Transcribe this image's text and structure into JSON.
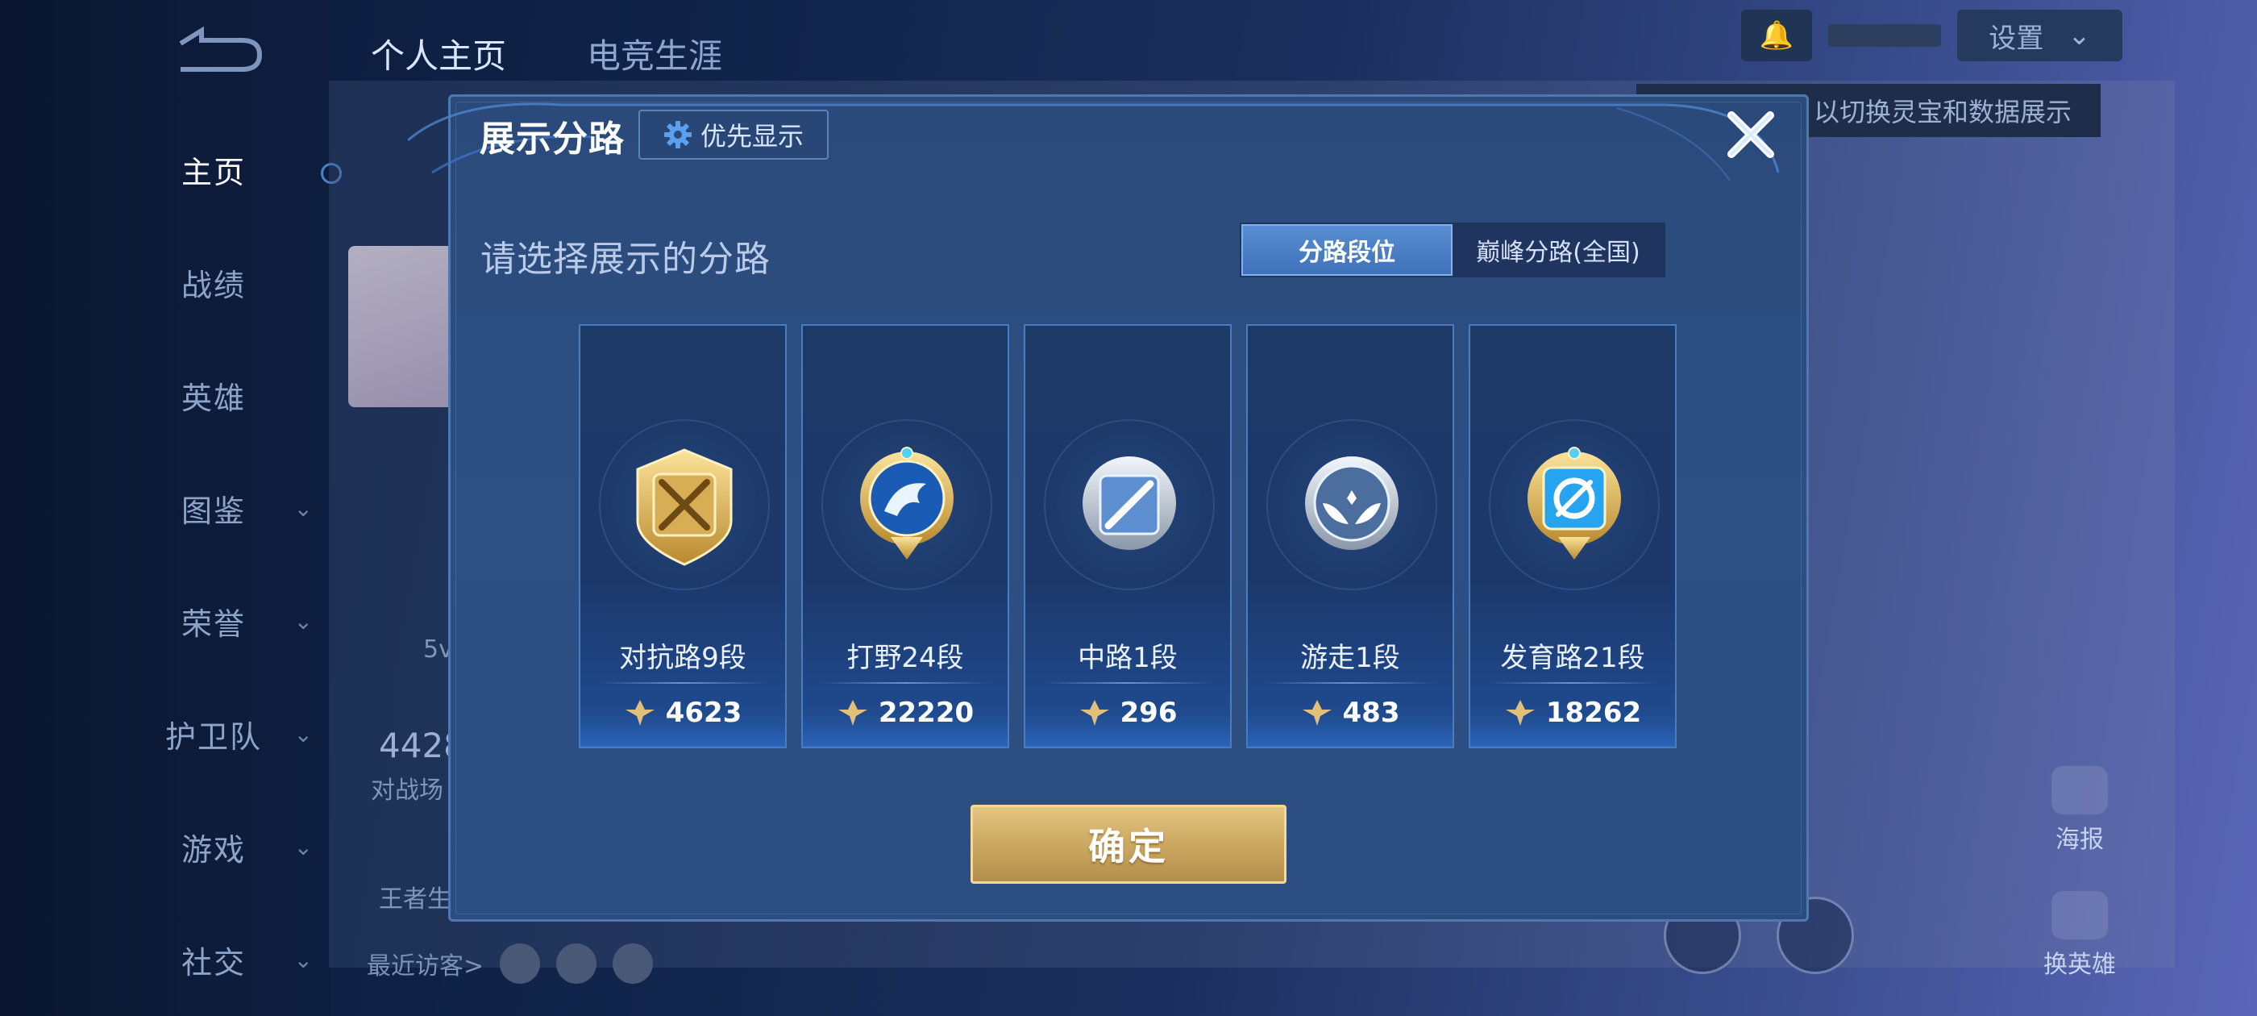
{
  "nav": {
    "items": [
      {
        "label": "主页",
        "active": true,
        "expandable": false
      },
      {
        "label": "战绩",
        "active": false,
        "expandable": false
      },
      {
        "label": "英雄",
        "active": false,
        "expandable": false
      },
      {
        "label": "图鉴",
        "active": false,
        "expandable": true
      },
      {
        "label": "荣誉",
        "active": false,
        "expandable": true
      },
      {
        "label": "护卫队",
        "active": false,
        "expandable": true
      },
      {
        "label": "游戏",
        "active": false,
        "expandable": true
      },
      {
        "label": "社交",
        "active": false,
        "expandable": true
      }
    ]
  },
  "background": {
    "tabs": [
      "个人主页",
      "电竞生涯"
    ],
    "stat_value": "4428",
    "stat_label": "对战场",
    "five_v": "5v",
    "king_text": "王者生",
    "recent_visitors": "最近访客>",
    "settings_label": "设置",
    "tooltip": "以切换灵宝和数据展示",
    "poster_label": "海报",
    "switch_hero_label": "换英雄"
  },
  "dialog": {
    "title": "展示分路",
    "priority_label": "优先显示",
    "subtitle": "请选择展示的分路",
    "segments": [
      "分路段位",
      "巅峰分路(全国)"
    ],
    "active_segment": 0,
    "cards": [
      {
        "rank": "对抗路9段",
        "points": "4623",
        "emblem": "crossed-swords-emblem-icon"
      },
      {
        "rank": "打野24段",
        "points": "22220",
        "emblem": "dragon-emblem-icon"
      },
      {
        "rank": "中路1段",
        "points": "296",
        "emblem": "staff-emblem-icon"
      },
      {
        "rank": "游走1段",
        "points": "483",
        "emblem": "wings-emblem-icon"
      },
      {
        "rank": "发育路21段",
        "points": "18262",
        "emblem": "target-emblem-icon"
      }
    ],
    "confirm_label": "确定"
  },
  "colors": {
    "accent_blue": "#3e71b8",
    "gold": "#c9a55e",
    "dialog_bg": "#2c4d80"
  }
}
